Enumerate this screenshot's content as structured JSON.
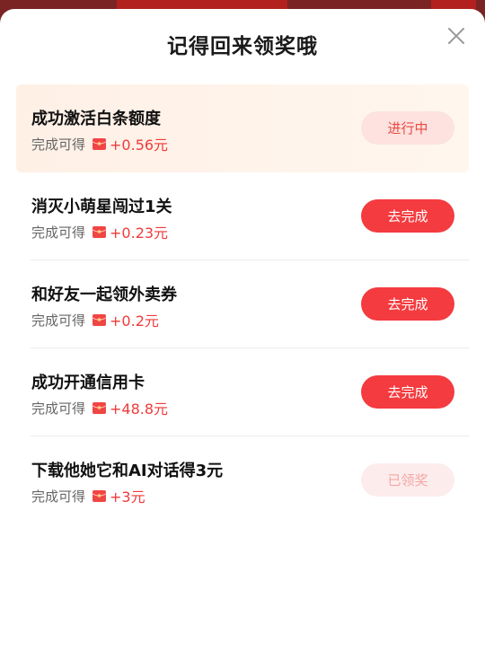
{
  "dialog": {
    "title": "记得回来领奖哦"
  },
  "reward_prefix": "完成可得",
  "tasks": [
    {
      "name": "成功激活白条额度",
      "amount": "+0.56元",
      "button": "进行中",
      "state": "progress"
    },
    {
      "name": "消灭小萌星闯过1关",
      "amount": "+0.23元",
      "button": "去完成",
      "state": "primary"
    },
    {
      "name": "和好友一起领外卖券",
      "amount": "+0.2元",
      "button": "去完成",
      "state": "primary"
    },
    {
      "name": "成功开通信用卡",
      "amount": "+48.8元",
      "button": "去完成",
      "state": "primary"
    },
    {
      "name": "下载他她它和AI对话得3元",
      "amount": "+3元",
      "button": "已领奖",
      "state": "done"
    }
  ],
  "icons": {
    "close": "close-icon",
    "reward": "red-packet-icon"
  },
  "colors": {
    "accent": "#f43b3f",
    "amount": "#f03a3a",
    "highlight_bg": "#fff2e8"
  }
}
